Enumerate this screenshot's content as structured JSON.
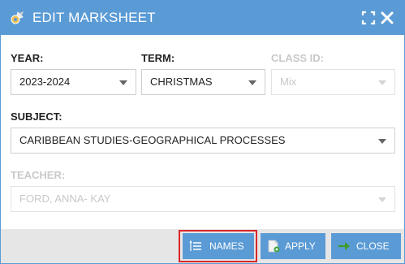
{
  "dialog": {
    "title": "EDIT MARKSHEET",
    "icon": "edit-tools-icon"
  },
  "form": {
    "year": {
      "label": "YEAR:",
      "value": "2023-2024"
    },
    "term": {
      "label": "TERM:",
      "value": "CHRISTMAS"
    },
    "class_id": {
      "label": "CLASS ID:",
      "value": "Mix"
    },
    "subject": {
      "label": "SUBJECT:",
      "value": "CARIBBEAN STUDIES-GEOGRAPHICAL PROCESSES"
    },
    "teacher": {
      "label": "TEACHER:",
      "value": "FORD, ANNA- KAY"
    }
  },
  "footer": {
    "names_label": "NAMES",
    "apply_label": "APPLY",
    "close_label": "CLOSE"
  },
  "colors": {
    "accent": "#5b9bd5",
    "highlight": "#d9262b",
    "footer_bg": "#e6e6e6",
    "disabled_text": "#c9c9c9"
  }
}
